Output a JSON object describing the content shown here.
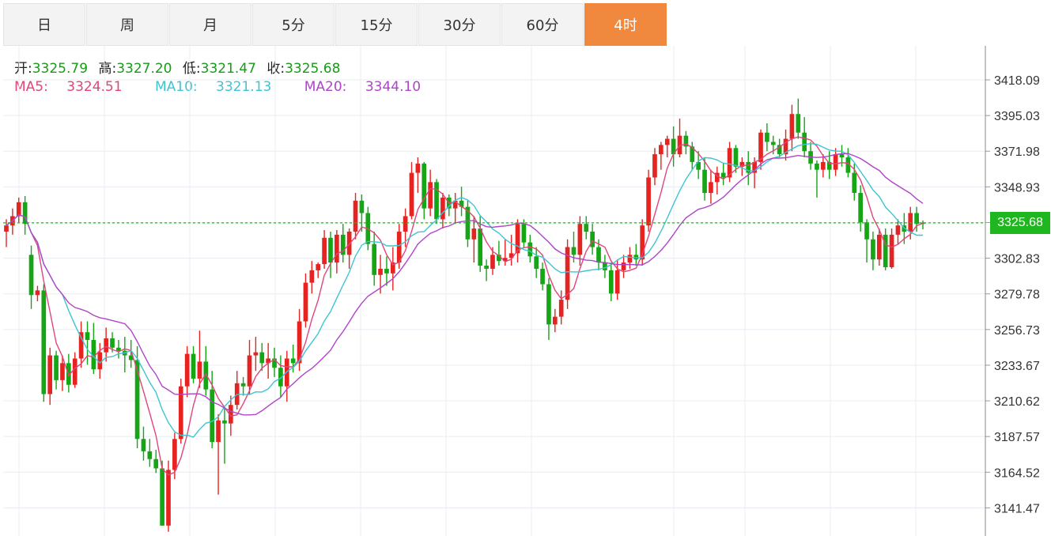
{
  "tabs": [
    "日",
    "周",
    "月",
    "5分",
    "15分",
    "30分",
    "60分",
    "4时"
  ],
  "active_tab": 7,
  "ohlc": {
    "open_label": "开:",
    "open": "3325.79",
    "high_label": "高:",
    "high": "3327.20",
    "low_label": "低:",
    "low": "3321.47",
    "close_label": "收:",
    "close": "3325.68"
  },
  "ma": {
    "ma5_label": "MA5:",
    "ma5": "3324.51",
    "ma10_label": "MA10:",
    "ma10": "3321.13",
    "ma20_label": "MA20:",
    "ma20": "3344.10"
  },
  "current_price": "3325.68",
  "colors": {
    "up": "#e52421",
    "down": "#15a515",
    "ma5": "#e0457b",
    "ma10": "#3fc4d4",
    "ma20": "#b044c8",
    "accent": "#f0893e",
    "price_line": "#22b822"
  },
  "chart_data": {
    "type": "candlestick",
    "yaxis_ticks": [
      3418.09,
      3395.03,
      3371.98,
      3348.93,
      3325.88,
      3302.83,
      3279.78,
      3256.73,
      3233.67,
      3210.62,
      3187.57,
      3164.52,
      3141.47
    ],
    "ylim": [
      3124,
      3436
    ],
    "current_price": 3325.68,
    "candles": [
      [
        3320,
        3328,
        3310,
        3324
      ],
      [
        3324,
        3335,
        3318,
        3330
      ],
      [
        3330,
        3342,
        3326,
        3339
      ],
      [
        3339,
        3343,
        3318,
        3325
      ],
      [
        3305,
        3311,
        3270,
        3279
      ],
      [
        3279,
        3285,
        3275,
        3282
      ],
      [
        3282,
        3286,
        3210,
        3215
      ],
      [
        3215,
        3245,
        3208,
        3240
      ],
      [
        3240,
        3243,
        3218,
        3224
      ],
      [
        3224,
        3240,
        3217,
        3235
      ],
      [
        3235,
        3241,
        3216,
        3221
      ],
      [
        3221,
        3242,
        3219,
        3238
      ],
      [
        3238,
        3262,
        3232,
        3255
      ],
      [
        3255,
        3262,
        3234,
        3250
      ],
      [
        3250,
        3261,
        3228,
        3231
      ],
      [
        3231,
        3248,
        3225,
        3242
      ],
      [
        3242,
        3258,
        3236,
        3251
      ],
      [
        3251,
        3255,
        3242,
        3245
      ],
      [
        3245,
        3250,
        3238,
        3243
      ],
      [
        3243,
        3252,
        3229,
        3240
      ],
      [
        3240,
        3250,
        3232,
        3237
      ],
      [
        3237,
        3246,
        3180,
        3186
      ],
      [
        3186,
        3194,
        3172,
        3178
      ],
      [
        3178,
        3186,
        3168,
        3173
      ],
      [
        3173,
        3179,
        3164,
        3167
      ],
      [
        3167,
        3172,
        3130,
        3130
      ],
      [
        3130,
        3172,
        3126,
        3166
      ],
      [
        3166,
        3190,
        3160,
        3186
      ],
      [
        3186,
        3225,
        3183,
        3220
      ],
      [
        3220,
        3246,
        3213,
        3241
      ],
      [
        3241,
        3246,
        3222,
        3225
      ],
      [
        3225,
        3256,
        3219,
        3236
      ],
      [
        3236,
        3246,
        3214,
        3218
      ],
      [
        3218,
        3230,
        3180,
        3184
      ],
      [
        3184,
        3202,
        3150,
        3198
      ],
      [
        3198,
        3206,
        3170,
        3196
      ],
      [
        3196,
        3214,
        3188,
        3208
      ],
      [
        3208,
        3230,
        3205,
        3222
      ],
      [
        3222,
        3226,
        3214,
        3220
      ],
      [
        3220,
        3250,
        3215,
        3240
      ],
      [
        3240,
        3252,
        3230,
        3242
      ],
      [
        3242,
        3248,
        3230,
        3235
      ],
      [
        3235,
        3248,
        3225,
        3238
      ],
      [
        3238,
        3245,
        3226,
        3232
      ],
      [
        3232,
        3240,
        3213,
        3220
      ],
      [
        3220,
        3243,
        3210,
        3238
      ],
      [
        3238,
        3247,
        3229,
        3235
      ],
      [
        3235,
        3270,
        3230,
        3262
      ],
      [
        3262,
        3293,
        3258,
        3287
      ],
      [
        3287,
        3301,
        3280,
        3295
      ],
      [
        3295,
        3300,
        3290,
        3299
      ],
      [
        3299,
        3321,
        3296,
        3316
      ],
      [
        3316,
        3320,
        3290,
        3300
      ],
      [
        3300,
        3321,
        3293,
        3318
      ],
      [
        3318,
        3325,
        3300,
        3305
      ],
      [
        3305,
        3322,
        3296,
        3320
      ],
      [
        3320,
        3345,
        3315,
        3340
      ],
      [
        3340,
        3344,
        3320,
        3332
      ],
      [
        3332,
        3336,
        3308,
        3312
      ],
      [
        3312,
        3320,
        3285,
        3292
      ],
      [
        3292,
        3305,
        3280,
        3296
      ],
      [
        3296,
        3304,
        3285,
        3293
      ],
      [
        3293,
        3310,
        3282,
        3300
      ],
      [
        3300,
        3325,
        3296,
        3320
      ],
      [
        3320,
        3335,
        3310,
        3330
      ],
      [
        3330,
        3365,
        3328,
        3358
      ],
      [
        3358,
        3368,
        3345,
        3364
      ],
      [
        3364,
        3365,
        3328,
        3335
      ],
      [
        3335,
        3360,
        3330,
        3352
      ],
      [
        3352,
        3354,
        3325,
        3328
      ],
      [
        3328,
        3345,
        3322,
        3342
      ],
      [
        3342,
        3344,
        3330,
        3335
      ],
      [
        3335,
        3345,
        3325,
        3340
      ],
      [
        3340,
        3349,
        3330,
        3336
      ],
      [
        3336,
        3340,
        3310,
        3315
      ],
      [
        3315,
        3330,
        3300,
        3322
      ],
      [
        3322,
        3330,
        3294,
        3298
      ],
      [
        3298,
        3302,
        3288,
        3296
      ],
      [
        3296,
        3310,
        3292,
        3305
      ],
      [
        3305,
        3314,
        3298,
        3301
      ],
      [
        3301,
        3315,
        3298,
        3303
      ],
      [
        3303,
        3318,
        3298,
        3306
      ],
      [
        3306,
        3328,
        3300,
        3325
      ],
      [
        3325,
        3328,
        3310,
        3313
      ],
      [
        3313,
        3318,
        3300,
        3304
      ],
      [
        3304,
        3310,
        3290,
        3296
      ],
      [
        3296,
        3300,
        3282,
        3286
      ],
      [
        3286,
        3290,
        3250,
        3260
      ],
      [
        3260,
        3270,
        3255,
        3265
      ],
      [
        3265,
        3282,
        3260,
        3276
      ],
      [
        3276,
        3315,
        3270,
        3310
      ],
      [
        3310,
        3320,
        3300,
        3305
      ],
      [
        3305,
        3330,
        3298,
        3325
      ],
      [
        3325,
        3330,
        3315,
        3320
      ],
      [
        3320,
        3325,
        3305,
        3310
      ],
      [
        3310,
        3315,
        3295,
        3300
      ],
      [
        3300,
        3305,
        3290,
        3295
      ],
      [
        3295,
        3300,
        3275,
        3280
      ],
      [
        3280,
        3302,
        3276,
        3295
      ],
      [
        3295,
        3305,
        3290,
        3300
      ],
      [
        3300,
        3310,
        3296,
        3305
      ],
      [
        3305,
        3312,
        3298,
        3302
      ],
      [
        3302,
        3328,
        3298,
        3324
      ],
      [
        3324,
        3360,
        3320,
        3355
      ],
      [
        3355,
        3374,
        3350,
        3370
      ],
      [
        3370,
        3378,
        3360,
        3376
      ],
      [
        3376,
        3382,
        3368,
        3380
      ],
      [
        3380,
        3388,
        3362,
        3370
      ],
      [
        3370,
        3393,
        3368,
        3382
      ],
      [
        3382,
        3385,
        3370,
        3375
      ],
      [
        3375,
        3378,
        3360,
        3365
      ],
      [
        3365,
        3372,
        3354,
        3360
      ],
      [
        3360,
        3368,
        3340,
        3345
      ],
      [
        3345,
        3360,
        3338,
        3352
      ],
      [
        3352,
        3362,
        3344,
        3358
      ],
      [
        3358,
        3364,
        3350,
        3355
      ],
      [
        3355,
        3378,
        3352,
        3374
      ],
      [
        3374,
        3376,
        3358,
        3362
      ],
      [
        3362,
        3368,
        3356,
        3365
      ],
      [
        3365,
        3372,
        3350,
        3358
      ],
      [
        3358,
        3368,
        3348,
        3365
      ],
      [
        3365,
        3386,
        3360,
        3384
      ],
      [
        3384,
        3390,
        3372,
        3378
      ],
      [
        3378,
        3382,
        3370,
        3376
      ],
      [
        3376,
        3380,
        3368,
        3370
      ],
      [
        3370,
        3386,
        3366,
        3380
      ],
      [
        3380,
        3402,
        3372,
        3396
      ],
      [
        3396,
        3406,
        3380,
        3384
      ],
      [
        3384,
        3394,
        3368,
        3372
      ],
      [
        3372,
        3378,
        3360,
        3364
      ],
      [
        3364,
        3366,
        3342,
        3360
      ],
      [
        3360,
        3370,
        3355,
        3365
      ],
      [
        3365,
        3372,
        3354,
        3360
      ],
      [
        3360,
        3374,
        3356,
        3370
      ],
      [
        3370,
        3376,
        3362,
        3368
      ],
      [
        3368,
        3374,
        3355,
        3358
      ],
      [
        3358,
        3364,
        3340,
        3345
      ],
      [
        3345,
        3350,
        3320,
        3326
      ],
      [
        3326,
        3328,
        3300,
        3315
      ],
      [
        3315,
        3320,
        3295,
        3302
      ],
      [
        3302,
        3322,
        3298,
        3318
      ],
      [
        3318,
        3322,
        3295,
        3297
      ],
      [
        3297,
        3322,
        3296,
        3318
      ],
      [
        3318,
        3328,
        3312,
        3324
      ],
      [
        3324,
        3332,
        3312,
        3320
      ],
      [
        3320,
        3336,
        3315,
        3332
      ],
      [
        3332,
        3336,
        3320,
        3325
      ],
      [
        3325.79,
        3327.2,
        3321.47,
        3325.68
      ]
    ]
  }
}
